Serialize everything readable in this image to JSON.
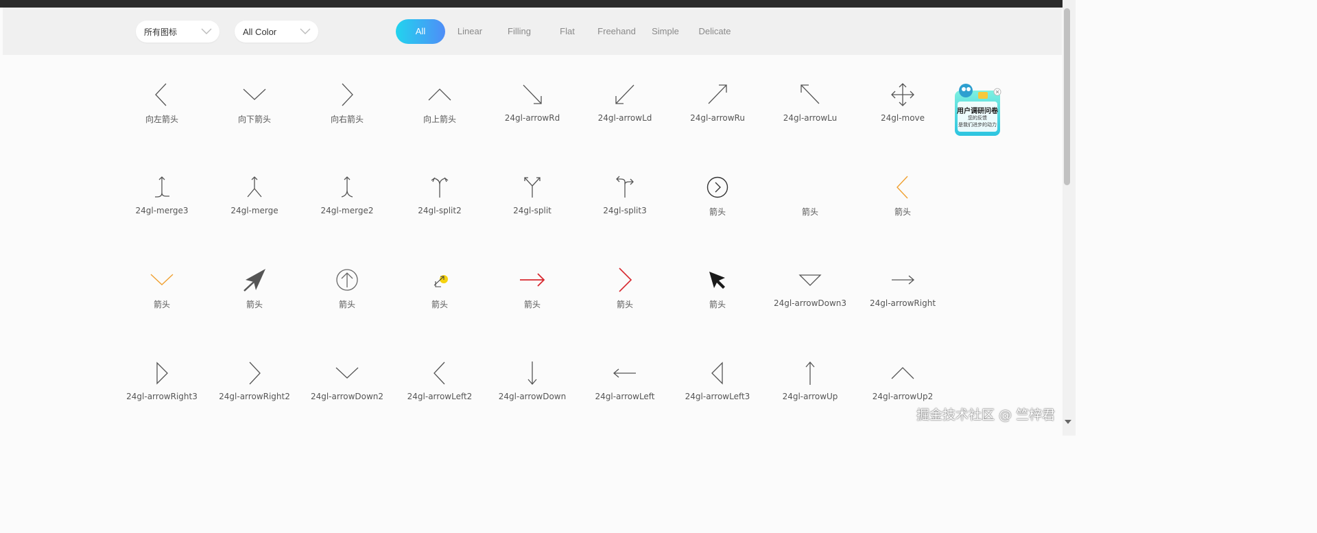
{
  "filters": {
    "icon_type": "所有图标",
    "color": "All Color"
  },
  "tabs": [
    "All",
    "Linear",
    "Filling",
    "Flat",
    "Freehand",
    "Simple",
    "Delicate"
  ],
  "active_tab": "All",
  "icons": [
    {
      "label": "向左箭头",
      "icon": "chevron-left-icon"
    },
    {
      "label": "向下箭头",
      "icon": "chevron-down-icon"
    },
    {
      "label": "向右箭头",
      "icon": "chevron-right-icon"
    },
    {
      "label": "向上箭头",
      "icon": "chevron-up-icon"
    },
    {
      "label": "24gl-arrowRd",
      "icon": "arrow-down-right-icon"
    },
    {
      "label": "24gl-arrowLd",
      "icon": "arrow-down-left-icon"
    },
    {
      "label": "24gl-arrowRu",
      "icon": "arrow-up-right-icon"
    },
    {
      "label": "24gl-arrowLu",
      "icon": "arrow-up-left-icon"
    },
    {
      "label": "24gl-move",
      "icon": "move-icon"
    },
    {
      "label": "24gl-merge3",
      "icon": "merge3-icon"
    },
    {
      "label": "24gl-merge",
      "icon": "merge-icon"
    },
    {
      "label": "24gl-merge2",
      "icon": "merge2-icon"
    },
    {
      "label": "24gl-split2",
      "icon": "split2-icon"
    },
    {
      "label": "24gl-split",
      "icon": "split-icon"
    },
    {
      "label": "24gl-split3",
      "icon": "split3-icon"
    },
    {
      "label": "箭头",
      "icon": "circle-chevron-right-icon"
    },
    {
      "label": "箭头",
      "icon": "blank-icon"
    },
    {
      "label": "箭头",
      "icon": "orange-chevron-left-icon"
    },
    {
      "label": "箭头",
      "icon": "orange-chevron-down-icon"
    },
    {
      "label": "箭头",
      "icon": "navigation-arrow-icon"
    },
    {
      "label": "箭头",
      "icon": "circle-arrow-up-icon"
    },
    {
      "label": "箭头",
      "icon": "yellow-cursor-arrow-icon"
    },
    {
      "label": "箭头",
      "icon": "red-arrow-right-icon"
    },
    {
      "label": "箭头",
      "icon": "red-chevron-right-icon"
    },
    {
      "label": "箭头",
      "icon": "cursor-pointer-icon"
    },
    {
      "label": "24gl-arrowDown3",
      "icon": "triangle-down-icon"
    },
    {
      "label": "24gl-arrowRight",
      "icon": "arrow-right-icon"
    },
    {
      "label": "24gl-arrowRight3",
      "icon": "triangle-right-icon"
    },
    {
      "label": "24gl-arrowRight2",
      "icon": "chevron-right-icon"
    },
    {
      "label": "24gl-arrowDown2",
      "icon": "chevron-down-icon"
    },
    {
      "label": "24gl-arrowLeft2",
      "icon": "chevron-left-icon"
    },
    {
      "label": "24gl-arrowDown",
      "icon": "arrow-down-icon"
    },
    {
      "label": "24gl-arrowLeft",
      "icon": "arrow-left-icon"
    },
    {
      "label": "24gl-arrowLeft3",
      "icon": "triangle-left-icon"
    },
    {
      "label": "24gl-arrowUp",
      "icon": "arrow-up-icon"
    },
    {
      "label": "24gl-arrowUp2",
      "icon": "chevron-up-icon"
    }
  ],
  "survey": {
    "title": "用户调研问卷",
    "line1": "您的反馈",
    "line2": "是我们进步的动力"
  },
  "watermark": "掘金技术社区 @ 竺梓君",
  "colors": {
    "accent_start": "#22d3ee",
    "accent_end": "#4f8df7",
    "icon_gray": "#555555",
    "orange": "#f0a030",
    "red": "#d7282f"
  }
}
